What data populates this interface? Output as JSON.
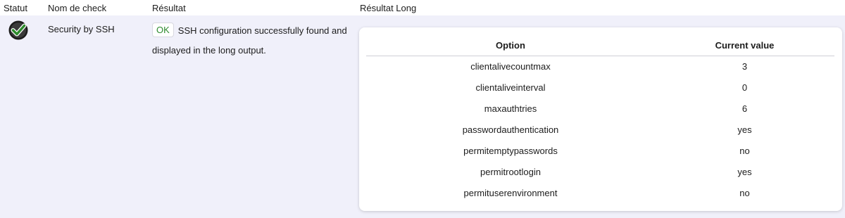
{
  "columns": {
    "status": "Statut",
    "check_name": "Nom de check",
    "result": "Résultat",
    "long_result": "Résultat Long"
  },
  "row": {
    "status_icon": "checkmark-ok-icon",
    "status_color": "#2e8b2e",
    "check_name": "Security by SSH",
    "badge": "OK",
    "result_text": "SSH configuration successfully found and displayed in the long output."
  },
  "long_table": {
    "headers": [
      "Option",
      "Current value"
    ],
    "rows": [
      [
        "clientalivecountmax",
        "3"
      ],
      [
        "clientaliveinterval",
        "0"
      ],
      [
        "maxauthtries",
        "6"
      ],
      [
        "passwordauthentication",
        "yes"
      ],
      [
        "permitemptypasswords",
        "no"
      ],
      [
        "permitrootlogin",
        "yes"
      ],
      [
        "permituserenvironment",
        "no"
      ]
    ]
  }
}
